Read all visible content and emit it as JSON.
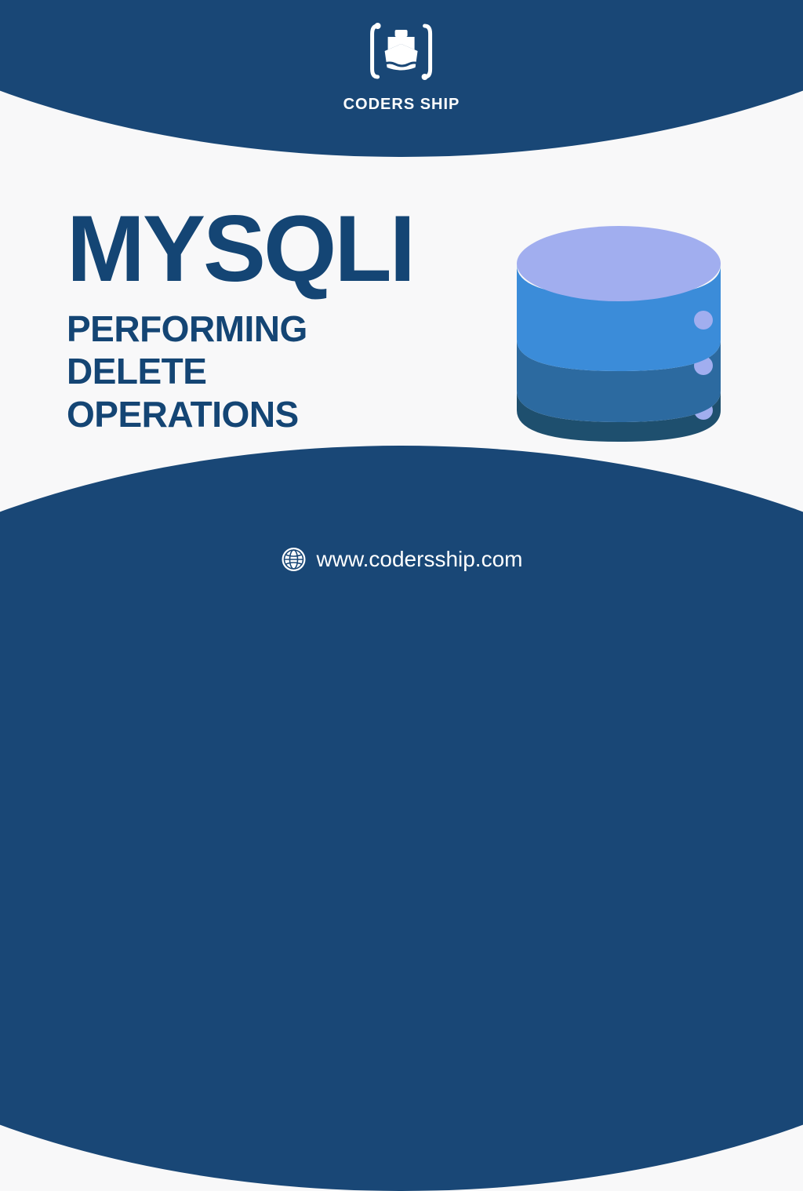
{
  "brand": {
    "name": "CODERS SHIP"
  },
  "headline": {
    "title": "MYSQLI",
    "subtitle_line1": "PERFORMING",
    "subtitle_line2": "DELETE",
    "subtitle_line3": "OPERATIONS"
  },
  "footer": {
    "url": "www.codersship.com"
  },
  "colors": {
    "primary": "#194776",
    "text": "#144574",
    "db_top": "#a1aeef",
    "db_mid": "#3b8cd9",
    "db_low": "#2c6aa0",
    "db_bottom": "#1e4f6e"
  }
}
